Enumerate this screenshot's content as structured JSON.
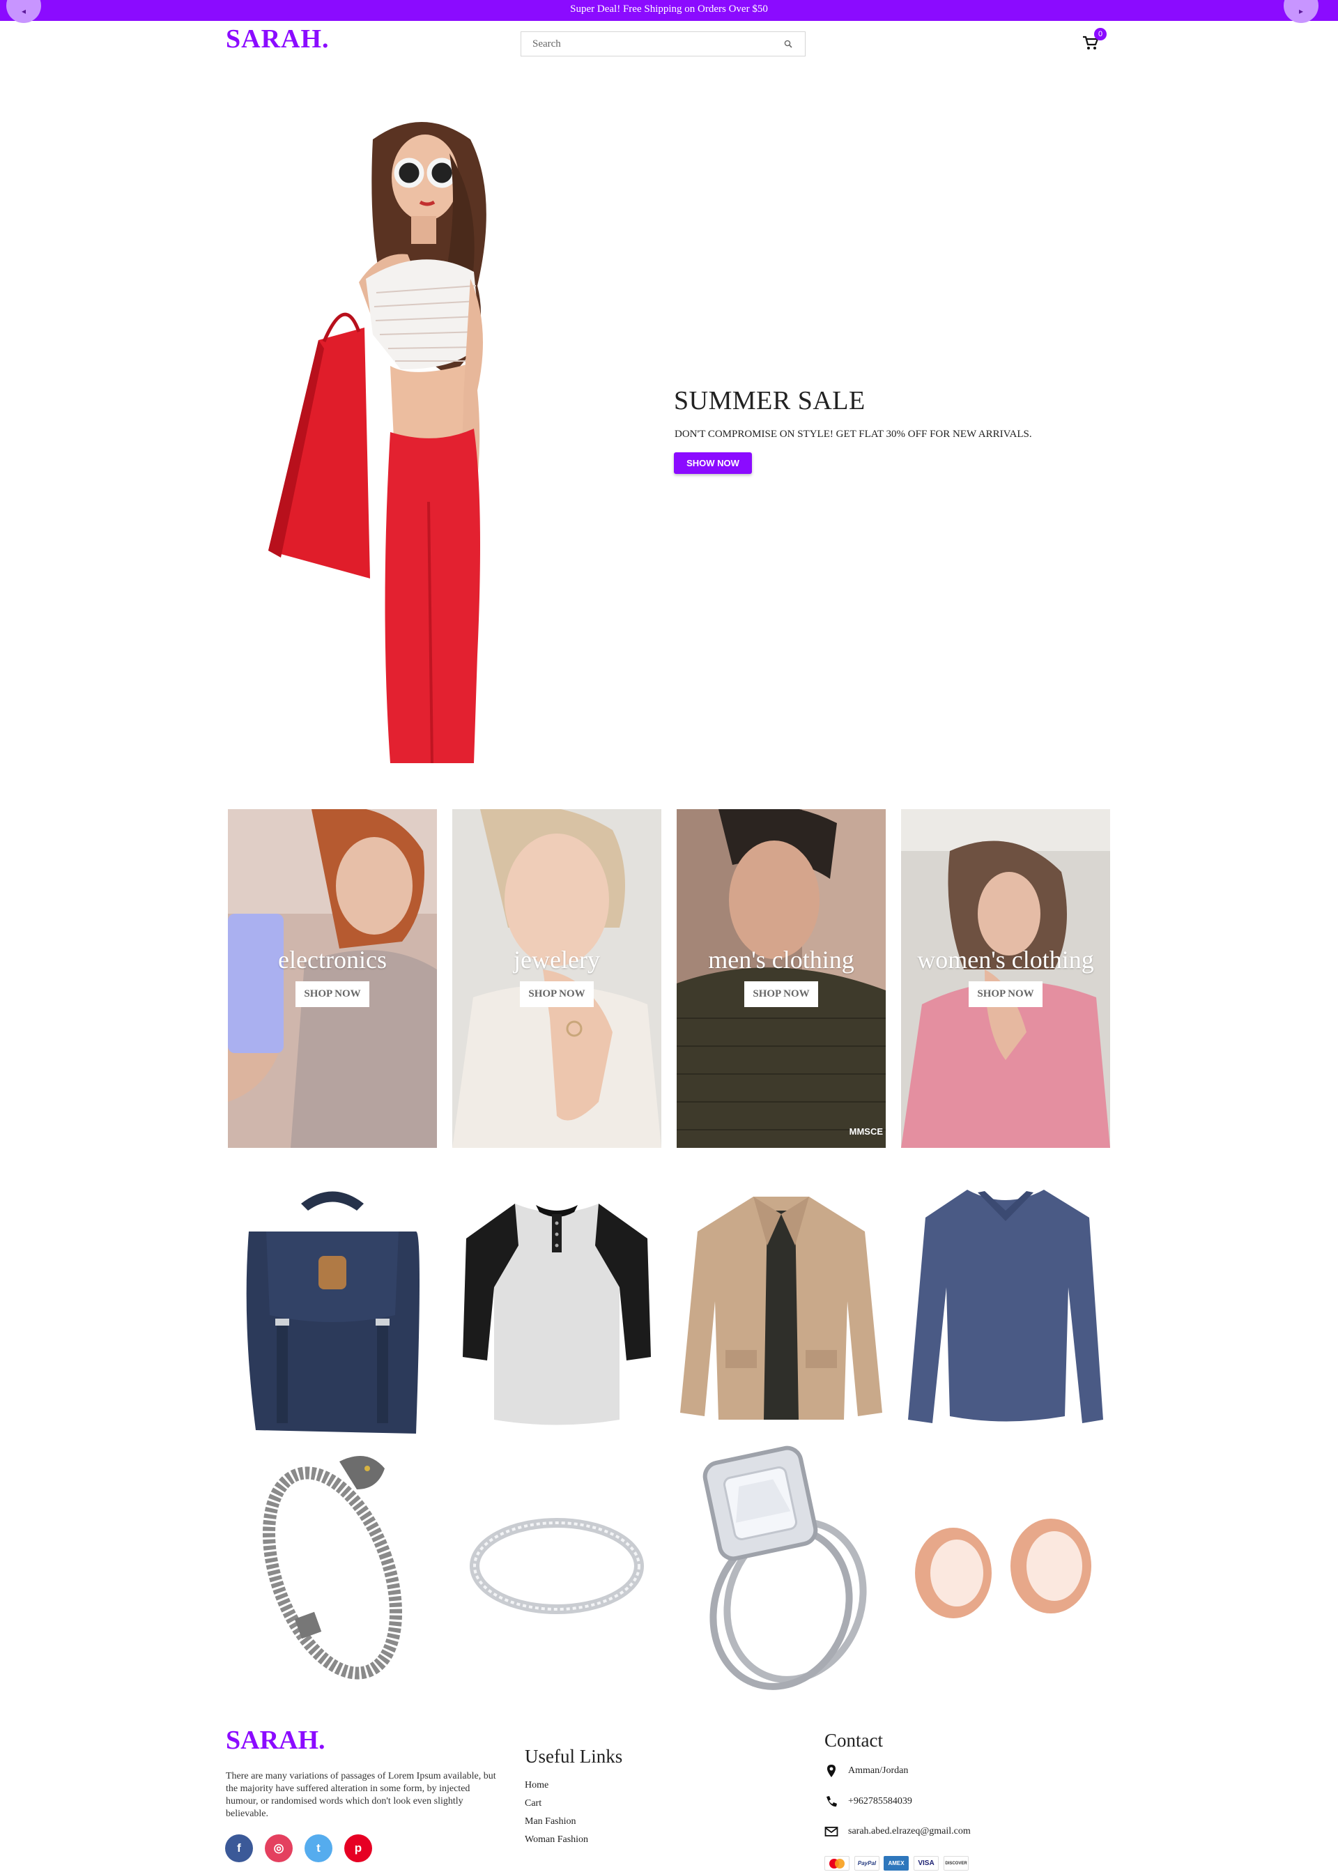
{
  "announcement": {
    "text": "Super Deal! Free Shipping on Orders Over $50",
    "prev_icon": "chevron-left-icon",
    "next_icon": "chevron-right-icon"
  },
  "header": {
    "logo": "SARAH.",
    "search_placeholder": "Search",
    "cart_count": "0"
  },
  "hero": {
    "title": "SUMMER SALE",
    "subtitle": "DON'T COMPROMISE ON STYLE! GET FLAT 30% OFF FOR NEW ARRIVALS.",
    "button": "SHOW NOW"
  },
  "categories": [
    {
      "title": "electronics",
      "button": "SHOP NOW"
    },
    {
      "title": "jewelery",
      "button": "SHOP NOW"
    },
    {
      "title": "men's clothing",
      "button": "SHOP NOW"
    },
    {
      "title": "women's clothing",
      "button": "SHOP NOW"
    }
  ],
  "category_watermark": "MMSCE",
  "products": [
    "backpack",
    "raglan-tee",
    "jacket",
    "long-sleeve-shirt",
    "dragon-bracelet",
    "silver-ring",
    "diamond-ring",
    "rose-gold-plugs"
  ],
  "footer": {
    "logo": "SARAH.",
    "description": "There are many variations of passages of Lorem Ipsum available, but the majority have suffered alteration in some form, by injected humour, or randomised words which don't look even slightly believable.",
    "useful_links_title": "Useful Links",
    "links": [
      "Home",
      "Cart",
      "Man Fashion",
      "Woman Fashion"
    ],
    "contact_title": "Contact",
    "address": "Amman/Jordan",
    "phone": "+962785584039",
    "email": "sarah.abed.elrazeq@gmail.com",
    "payments": [
      "MasterCard",
      "PayPal",
      "AMEX",
      "VISA",
      "DISCOVER"
    ]
  },
  "colors": {
    "accent": "#8b0bff",
    "facebook": "#3b5998",
    "instagram": "#e4405f",
    "twitter": "#55acee",
    "pinterest": "#e60023"
  }
}
